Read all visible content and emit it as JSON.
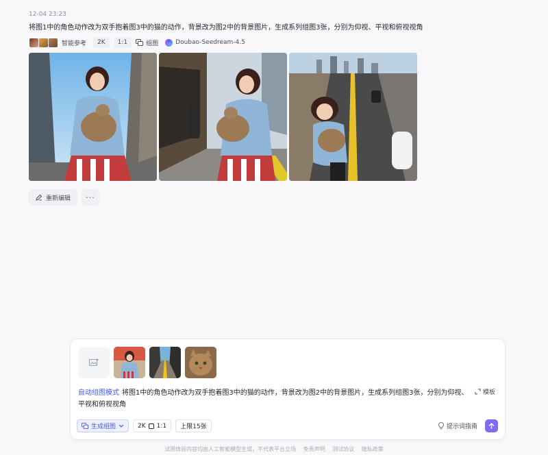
{
  "message": {
    "timestamp": "12-04 23:23",
    "prompt": "将图1中的角色动作改为双手抱着图3中的猫的动作，背景改为图2中的背景图片，生成系列组图3张，分别为仰视、平视和俯视视角",
    "meta": {
      "reference_label": "智能参考",
      "resolution": "2K",
      "ratio": "1:1",
      "group_label": "组图",
      "model": "Doubao-Seedream-4.5"
    },
    "images": [
      "generated-image-low-angle",
      "generated-image-eye-level",
      "generated-image-high-angle"
    ],
    "actions": {
      "reedit": "重新编辑",
      "more": "···"
    }
  },
  "composer": {
    "mode": "自动组图模式",
    "text": "将图1中的角色动作改为双手抱着图3中的猫的动作，背景改为图2中的背景图片，生成系列组图3张，分别为仰视、平视和俯视视角",
    "template": "模板",
    "toolbar": {
      "generate_group": "生成组图",
      "resolution": "2K",
      "ratio": "1:1",
      "limit": "上限15张"
    },
    "prompt_guide": "提示词指南"
  },
  "footer": {
    "disclaimer_text": "试用体验内容均由人工智能模型生成，不代表平台立场",
    "disclaimer": "免责声明",
    "terms": "测试协议",
    "privacy": "隐私政策"
  },
  "colors": {
    "accent": "#3d5af1",
    "send": "#7b6cf6"
  }
}
